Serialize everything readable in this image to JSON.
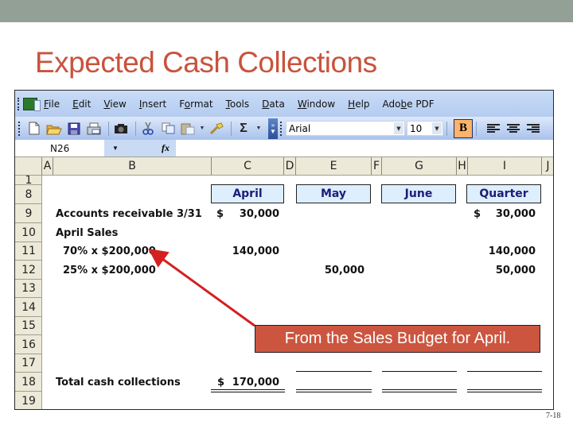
{
  "slide": {
    "title": "Expected Cash Collections",
    "page_number": "7-18",
    "callout_text": "From the Sales Budget for April.",
    "accent_color": "#c8533d"
  },
  "menubar": {
    "items": [
      {
        "label": "File",
        "mnemonic": "F"
      },
      {
        "label": "Edit",
        "mnemonic": "E"
      },
      {
        "label": "View",
        "mnemonic": "V"
      },
      {
        "label": "Insert",
        "mnemonic": "I"
      },
      {
        "label": "Format",
        "mnemonic": "o"
      },
      {
        "label": "Tools",
        "mnemonic": "T"
      },
      {
        "label": "Data",
        "mnemonic": "D"
      },
      {
        "label": "Window",
        "mnemonic": "W"
      },
      {
        "label": "Help",
        "mnemonic": "H"
      },
      {
        "label": "Adobe PDF",
        "mnemonic": "b"
      }
    ]
  },
  "toolbar": {
    "icons": [
      "new-icon",
      "open-icon",
      "save-icon",
      "print-preview-icon",
      "camera-icon",
      "cut-icon",
      "copy-icon",
      "paste-icon",
      "format-painter-icon",
      "autosum-icon"
    ],
    "autosum_symbol": "Σ",
    "font_name": "Arial",
    "font_size": "10",
    "bold_label": "B"
  },
  "formula_bar": {
    "name_box": "N26",
    "fx_label": "fx",
    "formula": ""
  },
  "columns": [
    "A",
    "B",
    "C",
    "D",
    "E",
    "F",
    "G",
    "H",
    "I",
    "J"
  ],
  "rows": [
    "1",
    "8",
    "9",
    "10",
    "11",
    "12",
    "13",
    "14",
    "15",
    "16",
    "17",
    "18",
    "19"
  ],
  "sheet": {
    "headers": {
      "april": "April",
      "may": "May",
      "june": "June",
      "quarter": "Quarter"
    },
    "r9": {
      "label": "Accounts receivable 3/31",
      "c_dollar": "$",
      "c_value": "30,000",
      "i_dollar": "$",
      "i_value": "30,000"
    },
    "r10": {
      "label": "April Sales"
    },
    "r11": {
      "label": "70% x $200,000",
      "c_value": "140,000",
      "i_value": "140,000"
    },
    "r12": {
      "label": "25% x $200,000",
      "e_value": "50,000",
      "i_value": "50,000"
    },
    "r18": {
      "label": "Total cash collections",
      "c_dollar": "$",
      "c_value": "170,000"
    }
  }
}
